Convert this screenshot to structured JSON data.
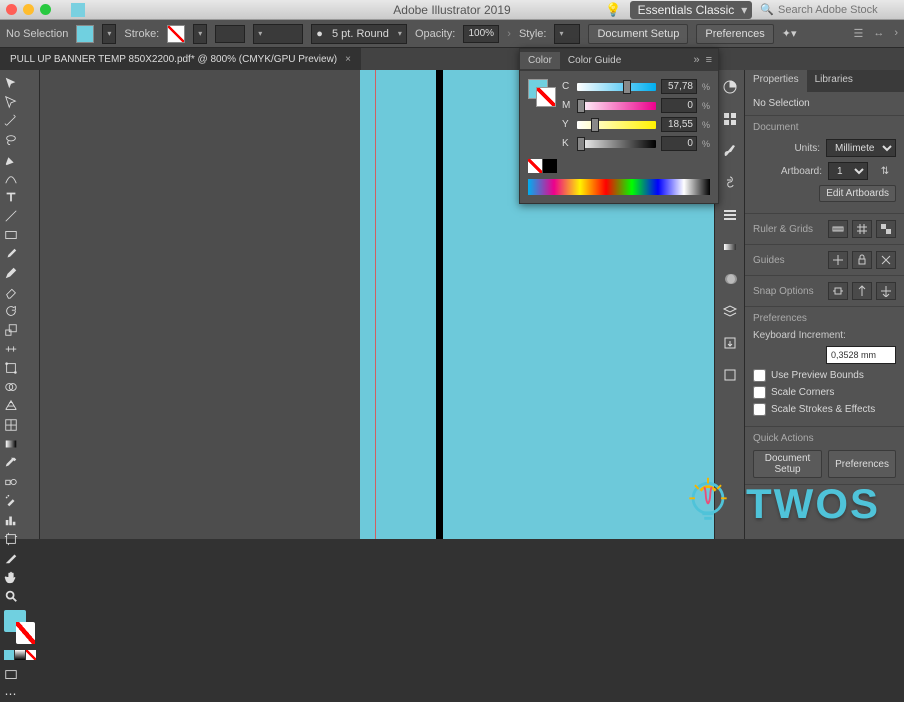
{
  "titlebar": {
    "app_name": "Adobe Illustrator 2019"
  },
  "workspace": {
    "label": "Essentials Classic"
  },
  "search": {
    "placeholder": "Search Adobe Stock"
  },
  "controlbar": {
    "selection_label": "No Selection",
    "stroke_label": "Stroke:",
    "profile_label": "5 pt. Round",
    "opacity_label": "Opacity:",
    "opacity_value": "100%",
    "style_label": "Style:",
    "doc_setup_btn": "Document Setup",
    "prefs_btn": "Preferences"
  },
  "doc_tab": {
    "title": "PULL UP BANNER TEMP 850X2200.pdf* @ 800% (CMYK/GPU Preview)"
  },
  "color_panel": {
    "tab_color": "Color",
    "tab_guide": "Color Guide",
    "c": {
      "label": "C",
      "value": "57,78"
    },
    "m": {
      "label": "M",
      "value": "0"
    },
    "y": {
      "label": "Y",
      "value": "18,55"
    },
    "k": {
      "label": "K",
      "value": "0"
    }
  },
  "props": {
    "tab_props": "Properties",
    "tab_libs": "Libraries",
    "no_selection": "No Selection",
    "sect_document": "Document",
    "units_label": "Units:",
    "units_value": "Millimeters",
    "artboard_label": "Artboard:",
    "artboard_value": "1",
    "edit_artboards_btn": "Edit Artboards",
    "ruler_grids": "Ruler & Grids",
    "guides": "Guides",
    "snap_options": "Snap Options",
    "sect_prefs": "Preferences",
    "keyinc_label": "Keyboard Increment:",
    "keyinc_value": "0,3528 mm",
    "cb_preview": "Use Preview Bounds",
    "cb_scale_corners": "Scale Corners",
    "cb_scale_strokes": "Scale Strokes & Effects",
    "quick_actions": "Quick Actions",
    "qa_doc_setup": "Document Setup",
    "qa_prefs": "Preferences"
  },
  "watermark": {
    "text": "TWOS"
  }
}
